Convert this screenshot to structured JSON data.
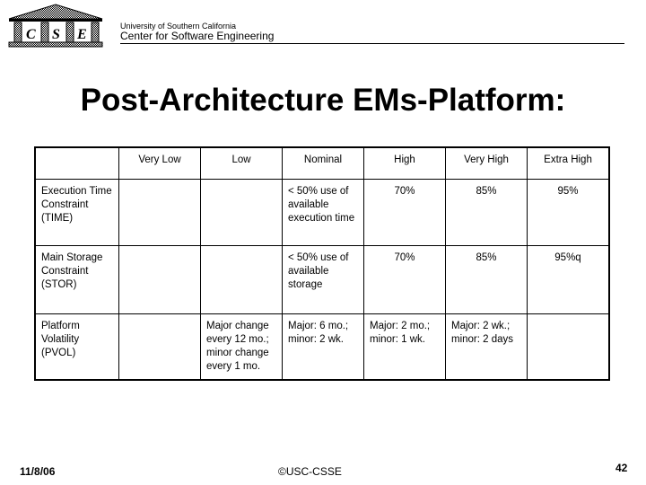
{
  "header": {
    "logo_text": "CSE",
    "logo_letters": [
      "C",
      "S",
      "E"
    ],
    "university": "University of Southern California",
    "center": "Center for Software  Engineering"
  },
  "title": "Post-Architecture EMs-Platform:",
  "table": {
    "columns": [
      "",
      "Very Low",
      "Low",
      "Nominal",
      "High",
      "Very High",
      "Extra High"
    ],
    "rows": [
      {
        "label": "Execution Time Constraint (TIME)",
        "cells": [
          "",
          "",
          "< 50% use of available execution time",
          "70%",
          "85%",
          "95%"
        ]
      },
      {
        "label": "Main Storage Constraint (STOR)",
        "cells": [
          "",
          "",
          "< 50% use of available storage",
          "70%",
          "85%",
          "95%q"
        ]
      },
      {
        "label": "Platform Volatility (PVOL)",
        "cells": [
          "",
          "Major change every 12 mo.; minor change every 1 mo.",
          "Major: 6 mo.; minor: 2 wk.",
          "Major: 2 mo.; minor: 1 wk.",
          "Major: 2 wk.; minor: 2 days",
          ""
        ]
      }
    ]
  },
  "footer": {
    "date": "11/8/06",
    "copyright": "©USC-CSSE",
    "page": "42"
  }
}
